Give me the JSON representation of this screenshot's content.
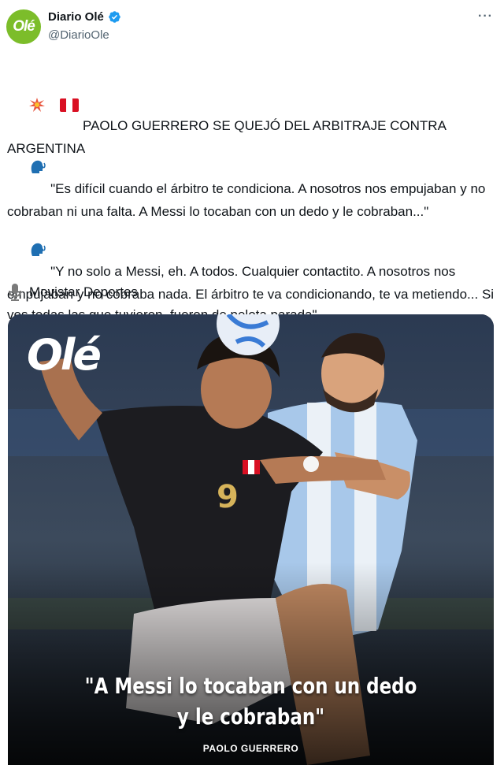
{
  "author": {
    "name": "Diario Olé",
    "handle": "@DiarioOle",
    "avatar_text": "Olé",
    "verified_color": "#1d9bf0",
    "brand_color": "#7cbd2a"
  },
  "more_label": "···",
  "headline": {
    "icons": [
      "collision-icon",
      "peru-flag-icon"
    ],
    "text": "PAOLO GUERRERO SE QUEJÓ DEL ARBITRAJE CONTRA ARGENTINA"
  },
  "quotes": [
    {
      "icon": "speaking-head-icon",
      "text": "\"Es difícil cuando el árbitro te condiciona. A nosotros nos empujaban y no cobraban ni una falta. A Messi lo tocaban con un dedo y le cobraban...\""
    },
    {
      "icon": "speaking-head-icon",
      "text": "\"Y no solo a Messi, eh. A todos. Cualquier contactito. A nosotros nos empujaban y no cobraba nada. El árbitro te va condicionando, te va metiendo... Si ves todas las que tuvieron, fueron de pelota parada\""
    }
  ],
  "source": {
    "icon": "microphone-icon",
    "label": "Movistar Deportes"
  },
  "media": {
    "logo_text": "Olé",
    "quote_line1": "\"A Messi lo tocaban con un dedo",
    "quote_line2": "y le cobraban\"",
    "caption": "PAOLO GUERRERO",
    "jersey_number": "9"
  }
}
